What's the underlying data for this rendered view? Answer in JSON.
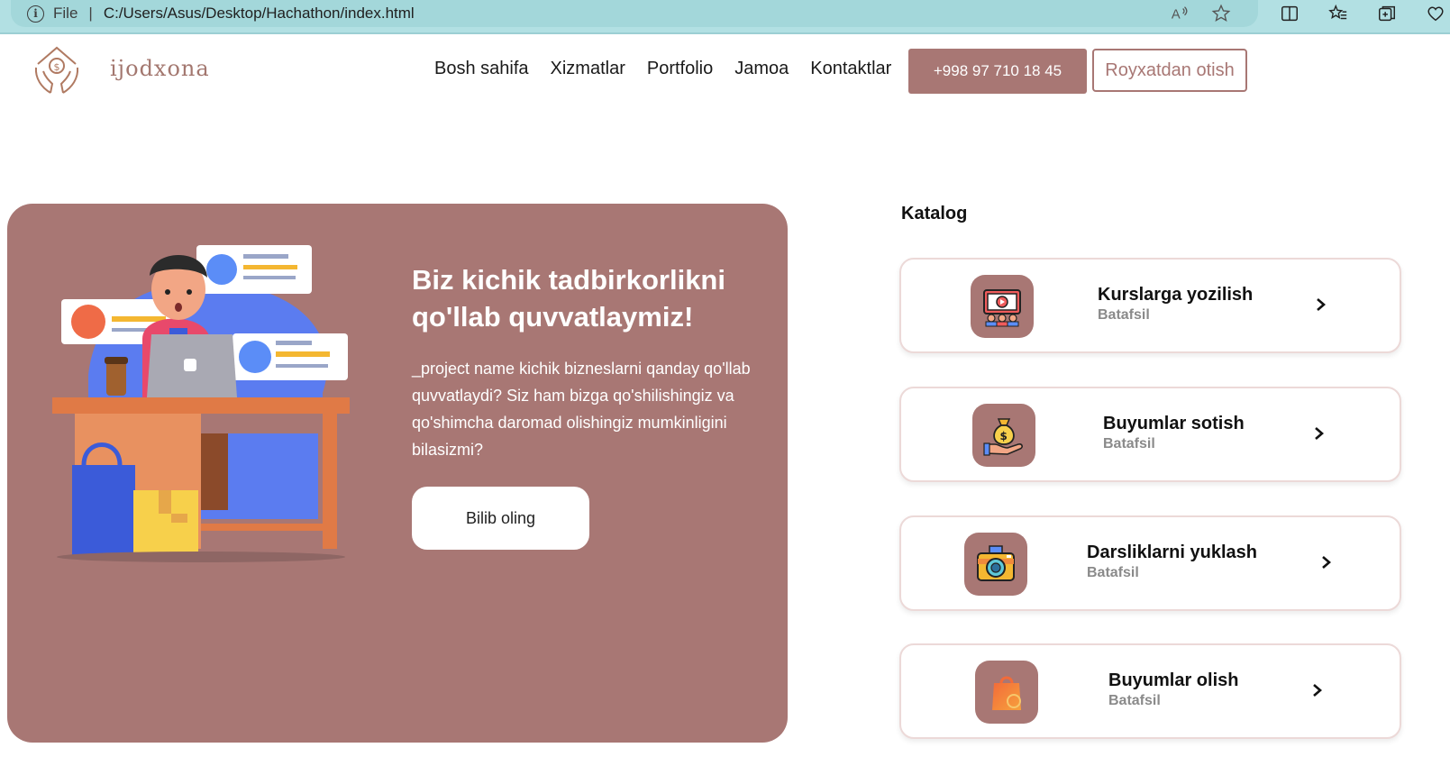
{
  "browser": {
    "file_label": "File",
    "separator": "|",
    "url": "C:/Users/Asus/Desktop/Hachathon/index.html"
  },
  "header": {
    "logo_text": "ijodxona",
    "nav": [
      "Bosh sahifa",
      "Xizmatlar",
      "Portfolio",
      "Jamoa",
      "Kontaktlar"
    ],
    "phone_button": "+998 97 710 18 45",
    "register_button": "Royxatdan otish"
  },
  "hero": {
    "title": "Biz kichik tadbirkorlikni qo'llab quvvatlaymiz!",
    "text": "_project name kichik bizneslarni qanday qo'llab quvvatlaydi? Siz ham bizga qo'shilishingiz va qo'shimcha daromad olishingiz mumkinligini bilasizmi?",
    "button": "Bilib oling"
  },
  "catalog": {
    "title": "Katalog",
    "items": [
      {
        "title": "Kurslarga yozilish",
        "sub": "Batafsil",
        "icon": "video-class-icon"
      },
      {
        "title": "Buyumlar sotish",
        "sub": "Batafsil",
        "icon": "money-bag-hand-icon"
      },
      {
        "title": "Darsliklarni yuklash",
        "sub": "Batafsil",
        "icon": "camera-icon"
      },
      {
        "title": "Buyumlar olish",
        "sub": "Batafsil",
        "icon": "shopping-bag-icon"
      }
    ]
  },
  "colors": {
    "brand": "#a87774",
    "browser_bar": "#b2e0e3"
  }
}
